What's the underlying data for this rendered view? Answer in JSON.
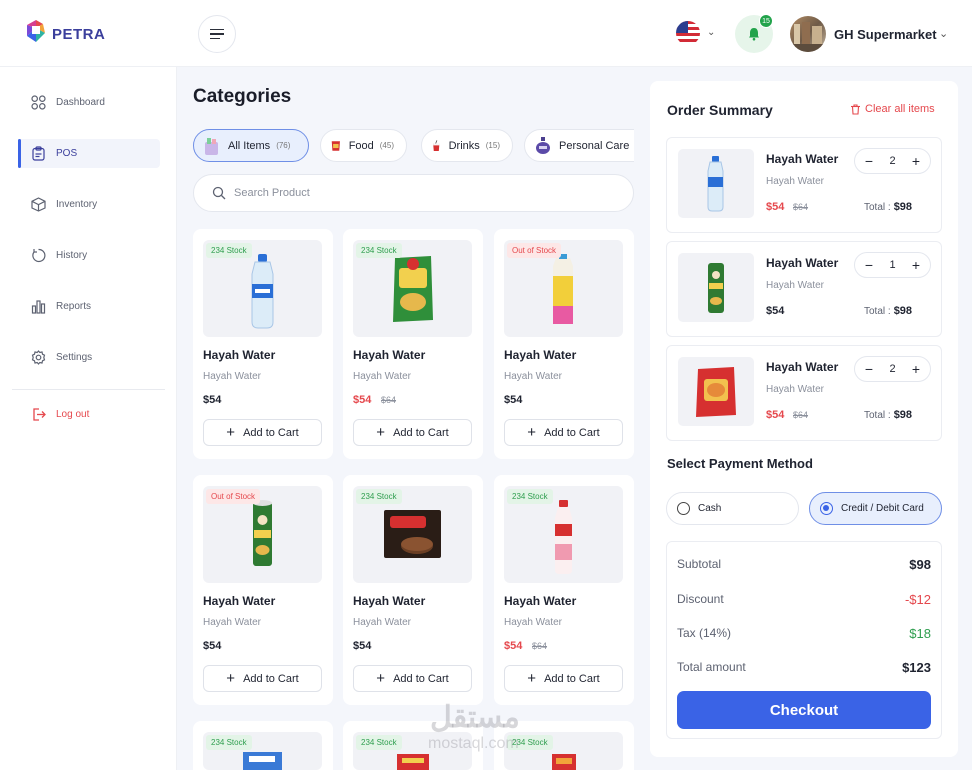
{
  "brand": {
    "logo_text": "PETRA"
  },
  "header": {
    "notifications_count": "15",
    "store_name": "GH Supermarket"
  },
  "sidebar": {
    "items": [
      {
        "label": "Dashboard",
        "icon": "dashboard-grid-icon",
        "active": false
      },
      {
        "label": "POS",
        "icon": "clipboard-icon",
        "active": true
      },
      {
        "label": "Inventory",
        "icon": "box-icon",
        "active": false
      },
      {
        "label": "History",
        "icon": "history-icon",
        "active": false
      },
      {
        "label": "Reports",
        "icon": "bar-chart-icon",
        "active": false
      },
      {
        "label": "Settings",
        "icon": "gear-icon",
        "active": false
      }
    ],
    "logout_label": "Log out"
  },
  "categories": {
    "title": "Categories",
    "chips": [
      {
        "label": "All Items",
        "count": "(76)",
        "active": true
      },
      {
        "label": "Food",
        "count": "(45)",
        "active": false
      },
      {
        "label": "Drinks",
        "count": "(15)",
        "active": false
      },
      {
        "label": "Personal Care",
        "count": "",
        "active": false
      }
    ],
    "search_placeholder": "Search Product"
  },
  "products": [
    {
      "badge": "234 Stock",
      "badge_type": "in",
      "name": "Hayah Water",
      "sub": "Hayah Water",
      "price": "$54",
      "old_price": "",
      "image": "water-bottle",
      "add_label": "Add to Cart"
    },
    {
      "badge": "234 Stock",
      "badge_type": "in",
      "name": "Hayah Water",
      "sub": "Hayah Water",
      "price": "$54",
      "old_price": "$64",
      "image": "chips-bag",
      "add_label": "Add to Cart"
    },
    {
      "badge": "Out of Stock",
      "badge_type": "out",
      "name": "Hayah Water",
      "sub": "Hayah Water",
      "price": "$54",
      "old_price": "",
      "image": "juice-carton",
      "add_label": "Add to Cart"
    },
    {
      "badge": "Out of Stock",
      "badge_type": "out",
      "name": "Hayah Water",
      "sub": "Hayah Water",
      "price": "$54",
      "old_price": "",
      "image": "pringles-can",
      "add_label": "Add to Cart"
    },
    {
      "badge": "234 Stock",
      "badge_type": "in",
      "name": "Hayah Water",
      "sub": "Hayah Water",
      "price": "$54",
      "old_price": "",
      "image": "biscuit-pack",
      "add_label": "Add to Cart"
    },
    {
      "badge": "234 Stock",
      "badge_type": "in",
      "name": "Hayah Water",
      "sub": "Hayah Water",
      "price": "$54",
      "old_price": "$64",
      "image": "milk-bottle",
      "add_label": "Add to Cart"
    },
    {
      "badge": "234 Stock",
      "badge_type": "in",
      "name": "",
      "sub": "",
      "price": "",
      "old_price": "",
      "image": "cereal-box",
      "add_label": ""
    },
    {
      "badge": "234 Stock",
      "badge_type": "in",
      "name": "",
      "sub": "",
      "price": "",
      "old_price": "",
      "image": "snack-pack",
      "add_label": ""
    },
    {
      "badge": "234 Stock",
      "badge_type": "in",
      "name": "",
      "sub": "",
      "price": "",
      "old_price": "",
      "image": "candy-pack",
      "add_label": ""
    }
  ],
  "order": {
    "title": "Order Summary",
    "clear_label": "Clear all items",
    "items": [
      {
        "name": "Hayah Water",
        "sub": "Hayah Water",
        "price": "$54",
        "old_price": "$64",
        "qty": "2",
        "total_label": "Total :",
        "total": "$98",
        "image": "water-bottle"
      },
      {
        "name": "Hayah Water",
        "sub": "Hayah Water",
        "price": "$54",
        "old_price": "",
        "qty": "1",
        "total_label": "Total :",
        "total": "$98",
        "image": "pringles-can"
      },
      {
        "name": "Hayah Water",
        "sub": "Hayah Water",
        "price": "$54",
        "old_price": "$64",
        "qty": "2",
        "total_label": "Total :",
        "total": "$98",
        "image": "chips-bag"
      }
    ],
    "payment_title": "Select Payment Method",
    "payment_options": [
      {
        "label": "Cash",
        "selected": false
      },
      {
        "label": "Credit / Debit Card",
        "selected": true
      }
    ],
    "summary": {
      "subtotal_label": "Subtotal",
      "subtotal": "$98",
      "discount_label": "Discount",
      "discount": "-$12",
      "tax_label": "Tax (14%)",
      "tax": "$18",
      "total_label": "Total amount",
      "total": "$123"
    },
    "checkout_label": "Checkout"
  },
  "watermark": {
    "arabic": "مستقل",
    "latin": "mostaql.com"
  },
  "colors": {
    "accent": "#3a63e6",
    "danger": "#e5484d",
    "success": "#2f9e4f",
    "brand": "#3b3f9c"
  }
}
